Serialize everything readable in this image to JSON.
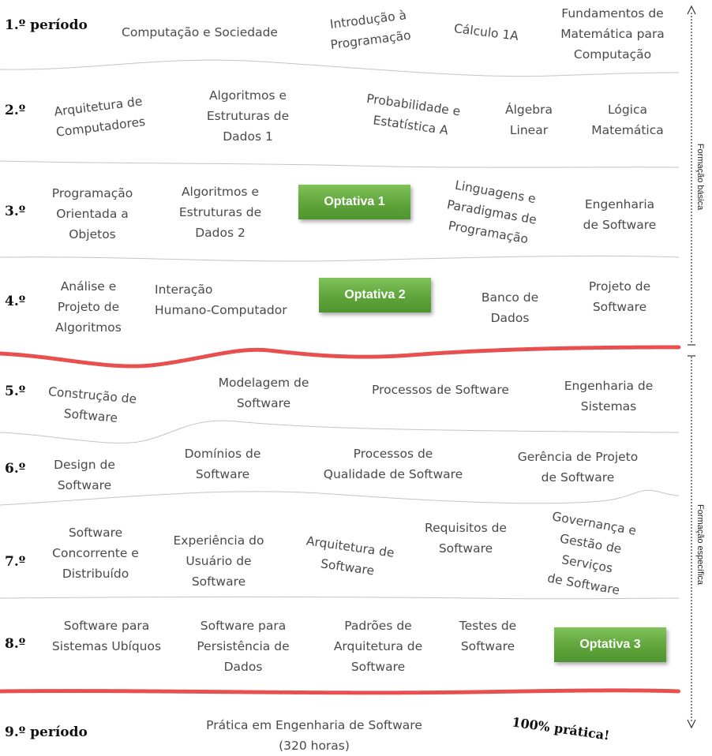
{
  "periods": [
    {
      "label": "1.º período"
    },
    {
      "label": "2.º"
    },
    {
      "label": "3.º"
    },
    {
      "label": "4.º"
    },
    {
      "label": "5.º"
    },
    {
      "label": "6.º"
    },
    {
      "label": "7.º"
    },
    {
      "label": "8.º"
    },
    {
      "label": "9.º período"
    }
  ],
  "courses": [
    {
      "label": "Computação e Sociedade"
    },
    {
      "label": "Introdução à\nProgramação"
    },
    {
      "label": "Cálculo 1A"
    },
    {
      "label": "Fundamentos de\nMatemática para\nComputação"
    },
    {
      "label": "Arquitetura de\nComputadores"
    },
    {
      "label": "Algoritmos e\nEstruturas de\nDados 1"
    },
    {
      "label": "Probabilidade e\nEstatística A"
    },
    {
      "label": "Álgebra\nLinear"
    },
    {
      "label": "Lógica\nMatemática"
    },
    {
      "label": "Programação\nOrientada a\nObjetos"
    },
    {
      "label": "Algoritmos e\nEstruturas de\nDados 2"
    },
    {
      "label": "Linguagens e\nParadigmas de\nProgramação"
    },
    {
      "label": "Engenharia\nde Software"
    },
    {
      "label": "Análise e\nProjeto de\nAlgoritmos"
    },
    {
      "label": "Interação\nHumano-Computador"
    },
    {
      "label": "Banco de\nDados"
    },
    {
      "label": "Projeto de\nSoftware"
    },
    {
      "label": "Construção de\nSoftware"
    },
    {
      "label": "Modelagem de\nSoftware"
    },
    {
      "label": "Processos de Software"
    },
    {
      "label": "Engenharia de\nSistemas"
    },
    {
      "label": "Design de\nSoftware"
    },
    {
      "label": "Domínios de\nSoftware"
    },
    {
      "label": "Processos de\nQualidade de Software"
    },
    {
      "label": "Gerência de Projeto\nde Software"
    },
    {
      "label": "Software\nConcorrente e\nDistribuído"
    },
    {
      "label": "Experiência do\nUsuário de\nSoftware"
    },
    {
      "label": "Arquitetura de\nSoftware"
    },
    {
      "label": "Requisitos de\nSoftware"
    },
    {
      "label": "Governança e\nGestão de\nServiços\nde Software"
    },
    {
      "label": "Software para\nSistemas Ubíquos"
    },
    {
      "label": "Software para\nPersistência de\nDados"
    },
    {
      "label": "Padrões de\nArquitetura de\nSoftware"
    },
    {
      "label": "Testes de\nSoftware"
    },
    {
      "label": "Prática em Engenharia de Software\n(320 horas)"
    }
  ],
  "optativas": [
    {
      "label": "Optativa 1"
    },
    {
      "label": "Optativa 2"
    },
    {
      "label": "Optativa 3"
    }
  ],
  "side_labels": {
    "formacao_basica": "Formação básica",
    "formacao_especifica": "Formação específica"
  },
  "pratica_badge": "100% prática!",
  "colors": {
    "optativa_green": "#5fa53a",
    "red_divider": "#e8504f",
    "gray_divider": "#c8c8c8"
  }
}
